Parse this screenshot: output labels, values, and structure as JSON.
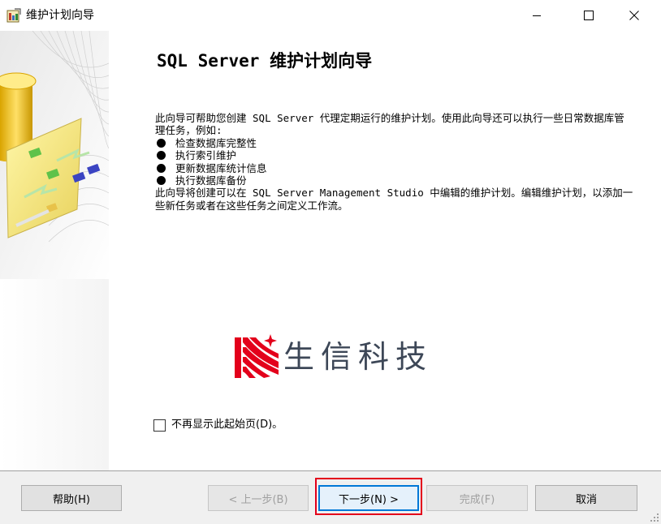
{
  "window": {
    "title": "维护计划向导",
    "icon": "wizard-app-icon",
    "controls": [
      "minimize-icon",
      "maximize-icon",
      "close-icon"
    ]
  },
  "page": {
    "heading": "SQL Server 维护计划向导",
    "intro": "此向导可帮助您创建 SQL Server 代理定期运行的维护计划。使用此向导还可以执行一些日常数据库管理任务，例如:",
    "bullets": [
      "检查数据库完整性",
      "执行索引维护",
      "更新数据库统计信息",
      "执行数据库备份"
    ],
    "outro": "此向导将创建可以在 SQL Server Management Studio 中编辑的维护计划。编辑维护计划，以添加一些新任务或者在这些任务之间定义工作流。",
    "logo_text": "生信科技",
    "checkbox_label": "不再显示此起始页(D)。",
    "checkbox_checked": false
  },
  "buttons": {
    "help": "帮助(H)",
    "back": "< 上一步(B)",
    "next": "下一步(N) >",
    "finish": "完成(F)",
    "cancel": "取消"
  },
  "colors": {
    "logo_red": "#e3001b",
    "logo_text": "#3d4757",
    "highlight": "#e3001b",
    "focus_blue": "#0078d7"
  }
}
